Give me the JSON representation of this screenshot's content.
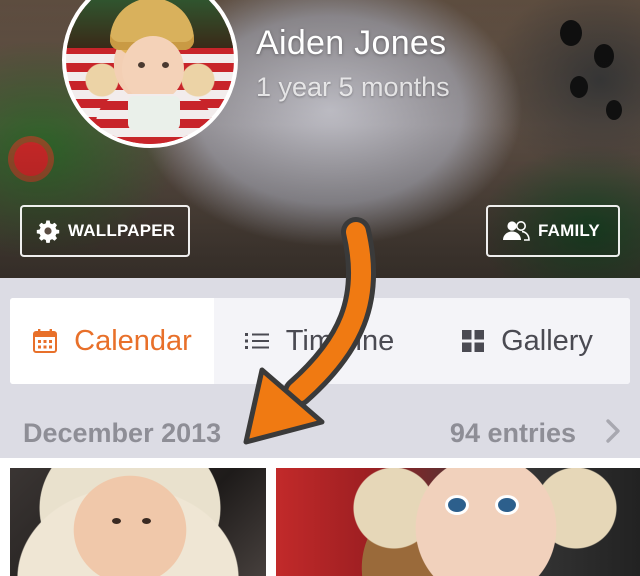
{
  "profile": {
    "name": "Aiden Jones",
    "age": "1 year 5 months"
  },
  "cover_buttons": {
    "wallpaper": {
      "label": "WALLPAPER",
      "icon": "gear-icon"
    },
    "family": {
      "label": "FAMILY",
      "icon": "people-icon"
    }
  },
  "tabs": [
    {
      "label": "Calendar",
      "icon": "calendar-icon",
      "active": true
    },
    {
      "label": "Timeline",
      "icon": "list-icon",
      "active": false
    },
    {
      "label": "Gallery",
      "icon": "grid-icon",
      "active": false
    }
  ],
  "month": {
    "title": "December 2013",
    "entries": "94 entries",
    "icon": "chevron-right-icon"
  },
  "colors": {
    "accent": "#e8702a",
    "arrow": "#f07a12",
    "muted_text": "#8e8e96",
    "background": "#dcdce4"
  }
}
